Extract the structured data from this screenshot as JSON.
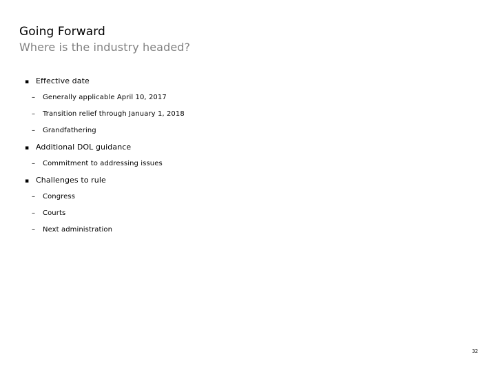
{
  "slide": {
    "title": "Going Forward",
    "subtitle": "Where is the industry headed?",
    "page_number": "32",
    "background_color": "#ffffff",
    "title_color": "#000000",
    "subtitle_color": "#808080",
    "body_text_color": "#000000"
  },
  "markers": {
    "level_1": "▪",
    "level_2": "–"
  },
  "outline": [
    {
      "level": 1,
      "label": "Effective date"
    },
    {
      "level": 2,
      "label": "Generally applicable April 10, 2017"
    },
    {
      "level": 2,
      "label": "Transition relief through January 1, 2018"
    },
    {
      "level": 2,
      "label": "Grandfathering"
    },
    {
      "level": 1,
      "label": "Additional DOL guidance"
    },
    {
      "level": 2,
      "label": "Commitment to addressing issues"
    },
    {
      "level": 1,
      "label": "Challenges to rule"
    },
    {
      "level": 2,
      "label": "Congress"
    },
    {
      "level": 2,
      "label": "Courts"
    },
    {
      "level": 2,
      "label": "Next administration"
    }
  ]
}
